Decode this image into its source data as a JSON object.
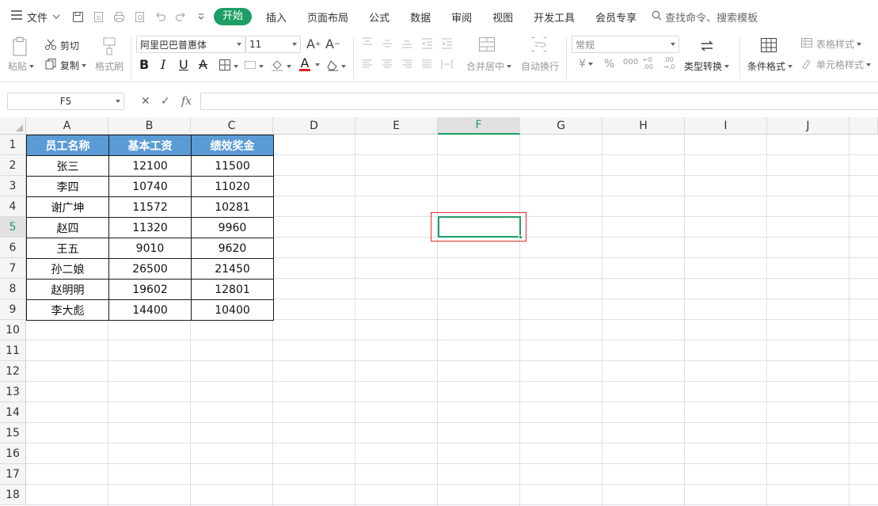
{
  "menubar": {
    "file_label": "文件",
    "tabs": [
      "开始",
      "插入",
      "页面布局",
      "公式",
      "数据",
      "审阅",
      "视图",
      "开发工具",
      "会员专享"
    ],
    "active_tab": "开始",
    "search_placeholder": "查找命令、搜索模板"
  },
  "ribbon": {
    "paste": "粘贴",
    "cut": "剪切",
    "copy": "复制",
    "format_painter": "格式刷",
    "font_name": "阿里巴巴普惠体",
    "font_size": "11",
    "bold": "B",
    "italic": "I",
    "underline": "U",
    "strike": "A",
    "font_color": "A",
    "merge_center": "合并居中",
    "wrap_text": "自动换行",
    "number_format": "常规",
    "currency": "¥",
    "percent": "%",
    "thousands": "000",
    "type_convert": "类型转换",
    "conditional_format": "条件格式",
    "table_style": "表格样式",
    "cell_style": "单元格样式"
  },
  "formula_bar": {
    "cell_ref": "F5",
    "fx_label": "fx",
    "value": ""
  },
  "columns": [
    "A",
    "B",
    "C",
    "D",
    "E",
    "F",
    "G",
    "H",
    "I",
    "J"
  ],
  "rows": [
    "1",
    "2",
    "3",
    "4",
    "5",
    "6",
    "7",
    "8",
    "9",
    "10",
    "11",
    "12",
    "13",
    "14",
    "15",
    "16",
    "17",
    "18"
  ],
  "selected_cell": {
    "col": "F",
    "row": "5"
  },
  "table": {
    "headers": [
      "员工名称",
      "基本工资",
      "绩效奖金"
    ],
    "rows": [
      [
        "张三",
        "12100",
        "11500"
      ],
      [
        "李四",
        "10740",
        "11020"
      ],
      [
        "谢广坤",
        "11572",
        "10281"
      ],
      [
        "赵四",
        "11320",
        "9960"
      ],
      [
        "王五",
        "9010",
        "9620"
      ],
      [
        "孙二娘",
        "26500",
        "21450"
      ],
      [
        "赵明明",
        "19602",
        "12801"
      ],
      [
        "李大彪",
        "14400",
        "10400"
      ]
    ]
  },
  "colors": {
    "accent": "#1d9e64",
    "header_fill": "#5b9bd5",
    "highlight": "#e0302c"
  }
}
